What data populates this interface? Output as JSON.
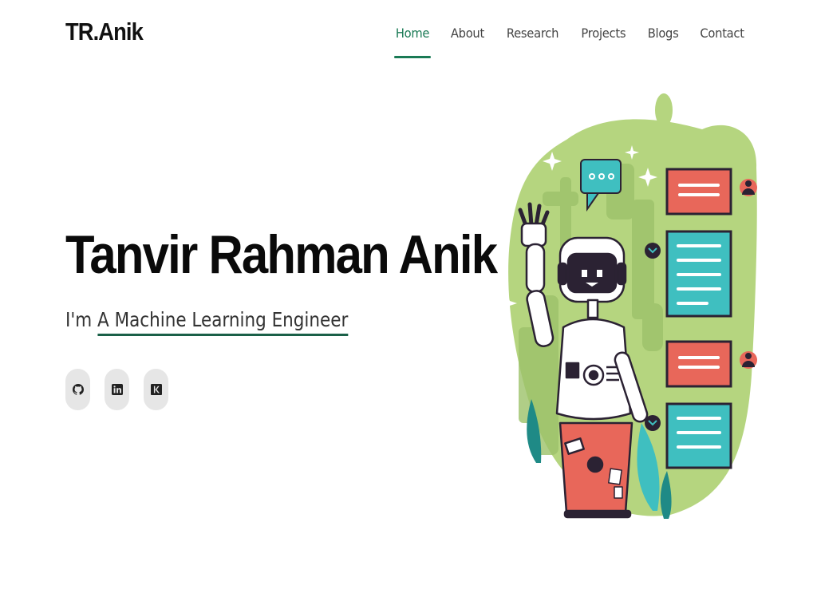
{
  "header": {
    "logo": "TR.Anik",
    "nav": [
      {
        "label": "Home",
        "active": true
      },
      {
        "label": "About"
      },
      {
        "label": "Research"
      },
      {
        "label": "Projects"
      },
      {
        "label": "Blogs"
      },
      {
        "label": "Contact"
      }
    ]
  },
  "hero": {
    "name": "Tanvir Rahman Anik",
    "subtitle_prefix": "I'm ",
    "subtitle_typed": "A Machine Learning Engineer"
  },
  "socials": [
    {
      "icon": "github-icon"
    },
    {
      "icon": "linkedin-icon"
    },
    {
      "icon": "kaggle-icon"
    }
  ],
  "colors": {
    "accent": "#1a7a55",
    "blob": "#b5d57f",
    "card_red": "#e8675a",
    "card_teal": "#3fbfc0",
    "dark": "#2b2233"
  }
}
